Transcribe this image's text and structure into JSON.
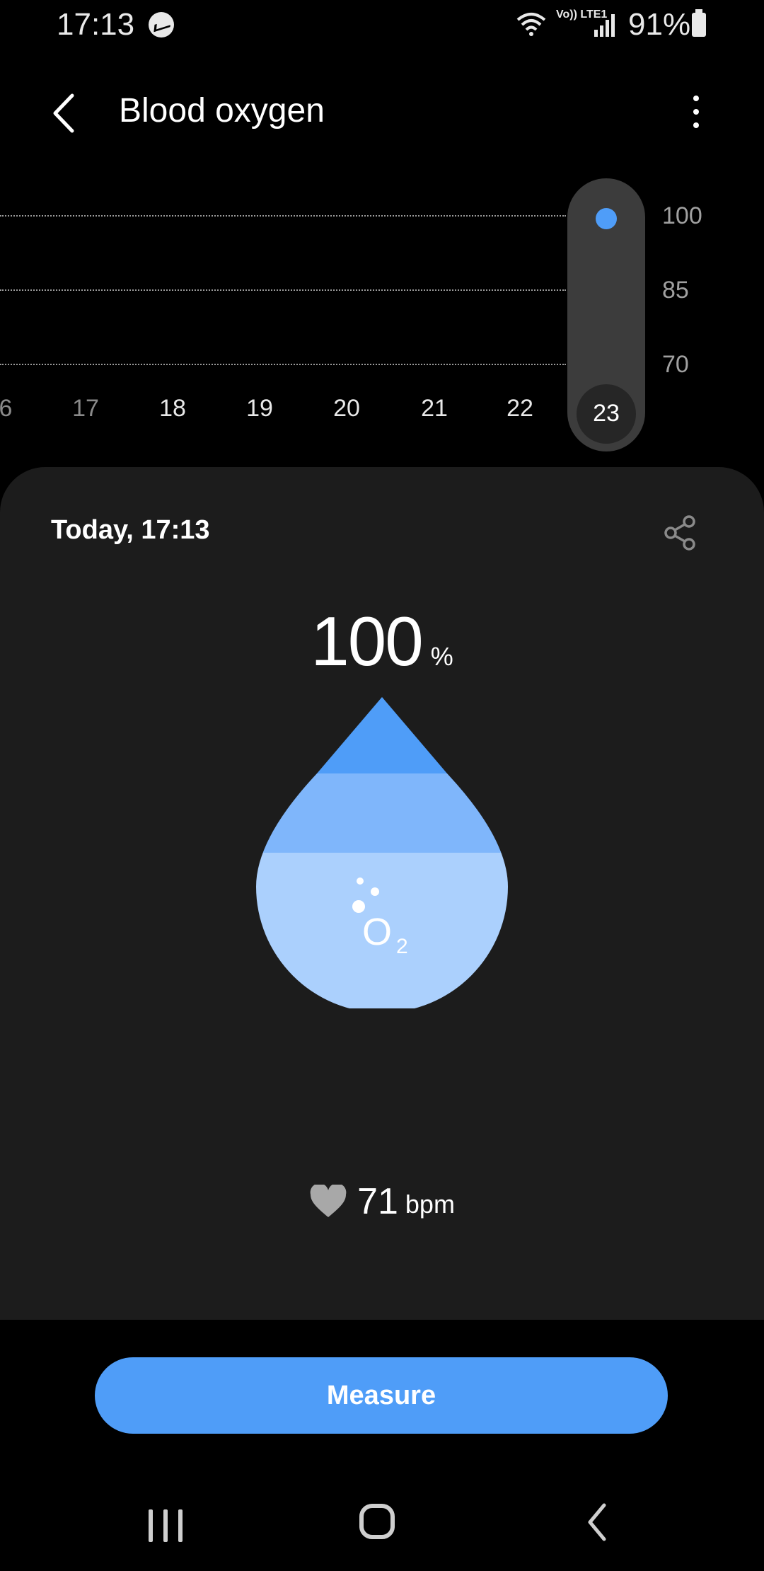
{
  "status_bar": {
    "time": "17:13",
    "network": "Vo)) LTE1",
    "battery": "91%",
    "icons": [
      "messenger-icon",
      "wifi-icon",
      "signal-icon",
      "battery-icon"
    ]
  },
  "header": {
    "title": "Blood oxygen",
    "back_icon": "chevron-left-icon",
    "menu_icon": "more-vertical-icon"
  },
  "chart_data": {
    "type": "scatter",
    "x": [
      "6",
      "17",
      "18",
      "19",
      "20",
      "21",
      "22",
      "23"
    ],
    "y_ticks": [
      "100",
      "85",
      "70"
    ],
    "points": [
      {
        "x": "23",
        "y": 100
      }
    ],
    "selected": "23",
    "accent_color": "#4f9df8"
  },
  "card": {
    "date": "Today, 17:13",
    "share_icon": "share-icon",
    "value": "100",
    "unit": "%",
    "drop_label": "O",
    "drop_label_sub": "2",
    "heart_rate": "71",
    "heart_rate_unit": "bpm"
  },
  "measure_button": "Measure",
  "nav_bar": {
    "icons": [
      "recents-icon",
      "home-icon",
      "back-icon"
    ]
  }
}
